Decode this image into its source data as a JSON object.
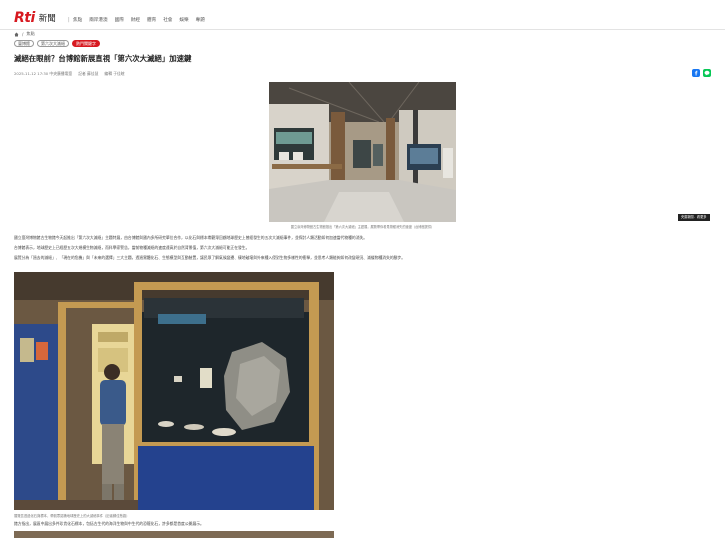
{
  "header": {
    "logo_text": "Rti",
    "logo_news": "新聞",
    "nav": [
      "焦點",
      "兩岸港澳",
      "國際",
      "財經",
      "體育",
      "社會",
      "娛樂",
      "專題"
    ]
  },
  "breadcrumb": {
    "current": "焦點"
  },
  "tags": [
    "臺博館",
    "第六次大滅絕",
    "熱門關鍵字"
  ],
  "article": {
    "title": "滅絕在眼前？台博館新展直視「第六次大滅絕」加速鍵",
    "date": "2025-11-12 17:30 中央廣播電臺",
    "author": "記者 蘇佳慧",
    "edit": "編輯 于佳暄",
    "image1_caption": "國立臺灣博物館古生物館推出「第六次大滅絕」主題展，展覽帶你看見物種消失的速度（台博館提供）",
    "image2_caption": "展覽區透過化石與標本，帶觀眾認識地球歷史上的大滅絕事件（記者蘇佳慧攝）",
    "paragraphs": [
      "國立臺灣博物館古生物館今天起推出「第六次大滅絕」主題特展，由台博館與國內多所研究單位合作，以化石與標本帶觀眾回顧地球歷史上曾經發生的五次大滅絕事件，並探討人類活動如何加速當代物種的消失。",
      "台博館表示，地球歷史上已經歷五次大規模生物滅絕，而科學家警告，當前物種滅絕的速度遠高於自然背景值，第六次大滅絕可能正在發生。",
      "展覽分為「過去的滅絕」、「現在的危機」與「未來的選擇」三大主題，透過實體化石、生態模型與互動裝置，讓民眾了解氣候變遷、棲地破壞與外來種入侵對生物多樣性的衝擊，並思考人類能夠如何改變現況、減緩物種消失的腳步。",
      "館方指出，展區中展出多件珍貴化石標本，包括古生代的海洋生物與中生代的恐龍化石，許多都是首度公開展示。"
    ]
  },
  "badge": "央廣新聞．看更多",
  "colors": {
    "brand": "#d71920",
    "facebook": "#1877f2",
    "line": "#06c755"
  }
}
